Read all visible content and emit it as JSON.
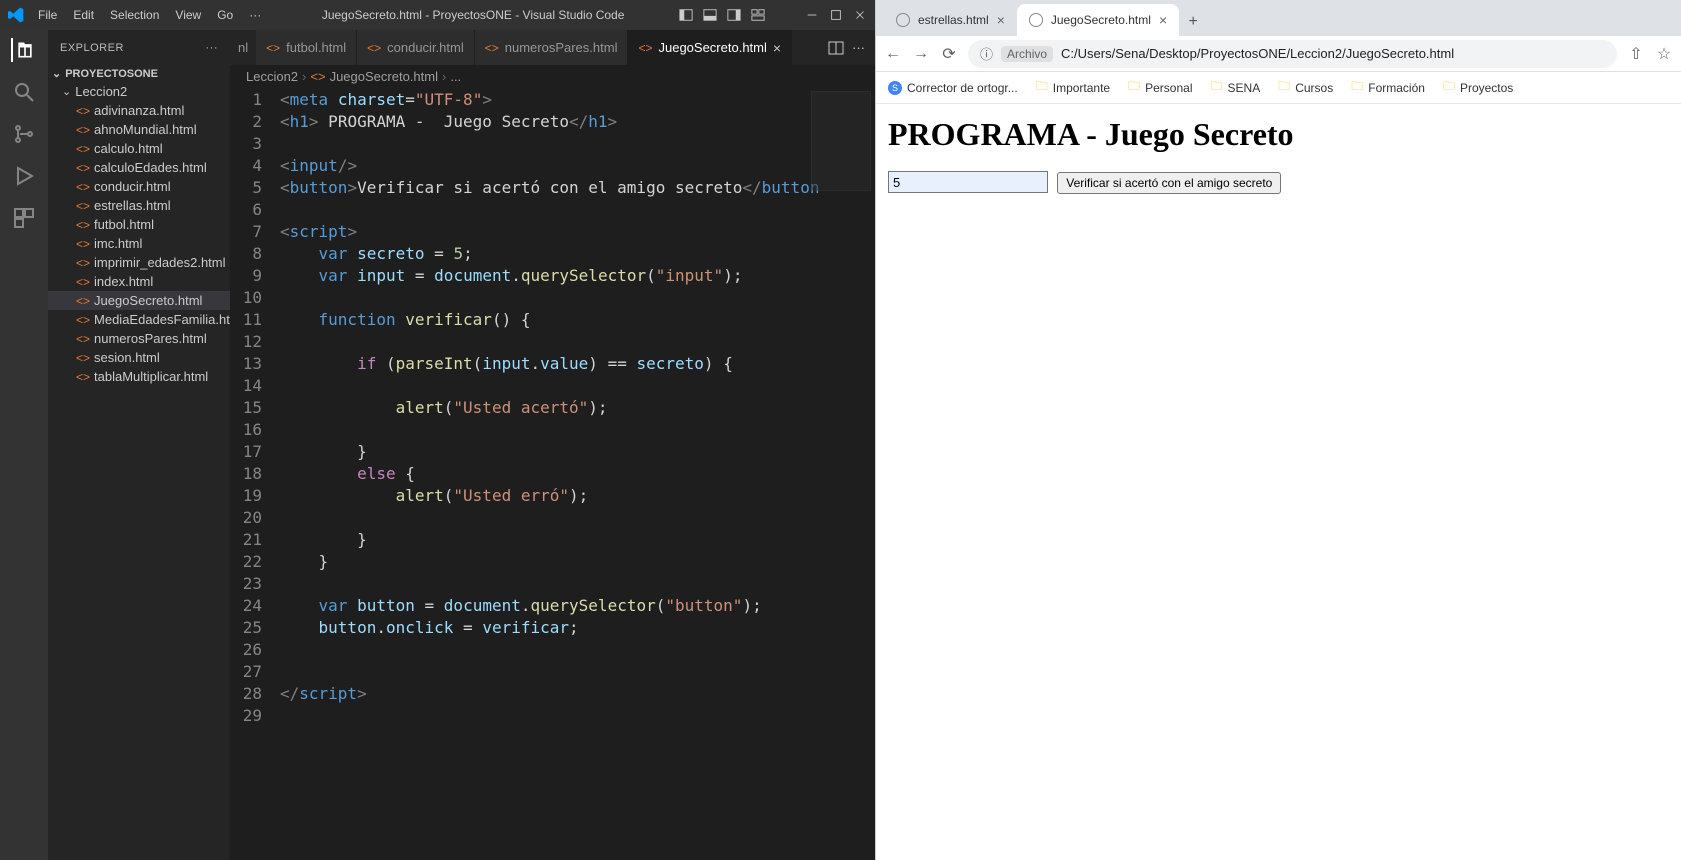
{
  "vscode": {
    "menu": [
      "File",
      "Edit",
      "Selection",
      "View",
      "Go",
      "···"
    ],
    "title": "JuegoSecreto.html - ProyectosONE - Visual Studio Code",
    "explorer_label": "EXPLORER",
    "project_name": "PROYECTOSONE",
    "folder": "Leccion2",
    "files": [
      "adivinanza.html",
      "ahnoMundial.html",
      "calculo.html",
      "calculoEdades.html",
      "conducir.html",
      "estrellas.html",
      "futbol.html",
      "imc.html",
      "imprimir_edades2.html",
      "index.html",
      "JuegoSecreto.html",
      "MediaEdadesFamilia.html",
      "numerosPares.html",
      "sesion.html",
      "tablaMultiplicar.html"
    ],
    "open_tabs": [
      {
        "partial": "nl"
      },
      {
        "label": "futbol.html"
      },
      {
        "label": "conducir.html"
      },
      {
        "label": "numerosPares.html"
      },
      {
        "label": "JuegoSecreto.html",
        "active": true
      }
    ],
    "breadcrumb": [
      "Leccion2",
      "JuegoSecreto.html",
      "..."
    ],
    "line_count": 29
  },
  "browser": {
    "tabs": [
      {
        "label": "estrellas.html"
      },
      {
        "label": "JuegoSecreto.html",
        "active": true
      }
    ],
    "url_prefix": "Archivo",
    "url": "C:/Users/Sena/Desktop/ProyectosONE/Leccion2/JuegoSecreto.html",
    "bookmarks": [
      {
        "label": "Corrector de ortogr...",
        "kind": "s"
      },
      {
        "label": "Importante",
        "kind": "folder"
      },
      {
        "label": "Personal",
        "kind": "folder"
      },
      {
        "label": "SENA",
        "kind": "folder"
      },
      {
        "label": "Cursos",
        "kind": "folder"
      },
      {
        "label": "Formación",
        "kind": "folder"
      },
      {
        "label": "Proyectos",
        "kind": "folder"
      }
    ],
    "page": {
      "heading": "PROGRAMA - Juego Secreto",
      "input_value": "5",
      "button_label": "Verificar si acertó con el amigo secreto"
    }
  }
}
